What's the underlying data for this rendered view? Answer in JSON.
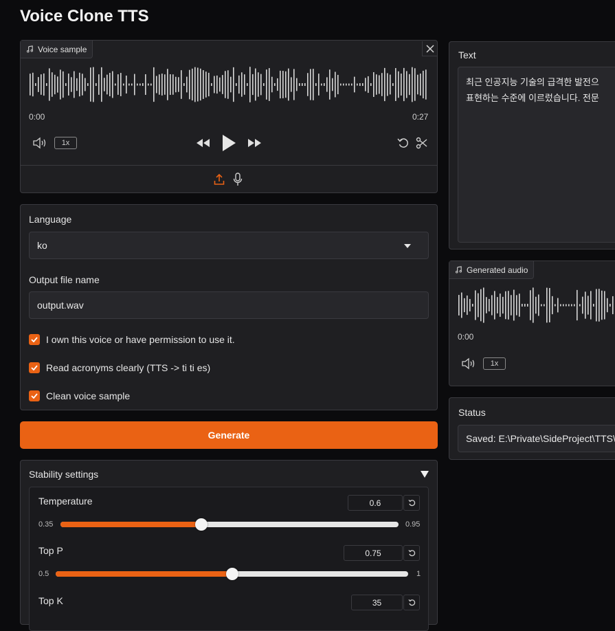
{
  "app": {
    "title": "Voice Clone TTS"
  },
  "voice_sample": {
    "tag": "Voice sample",
    "time_start": "0:00",
    "time_end": "0:27",
    "speed": "1x"
  },
  "settings": {
    "language_label": "Language",
    "language_value": "ko",
    "output_label": "Output file name",
    "output_value": "output.wav",
    "checkboxes": [
      {
        "label": "I own this voice or have permission to use it.",
        "checked": true
      },
      {
        "label": "Read acronyms clearly (TTS -> ti ti es)",
        "checked": true
      },
      {
        "label": "Clean voice sample",
        "checked": true
      }
    ]
  },
  "generate": {
    "label": "Generate"
  },
  "stability": {
    "title": "Stability settings",
    "sliders": [
      {
        "label": "Temperature",
        "value": "0.6",
        "min": "0.35",
        "max": "0.95",
        "fraction": 0.417
      },
      {
        "label": "Top P",
        "value": "0.75",
        "min": "0.5",
        "max": "1",
        "fraction": 0.5
      },
      {
        "label": "Top K",
        "value": "35"
      }
    ]
  },
  "text_panel": {
    "label": "Text",
    "line1": "최근 인공지능 기술의 급격한 발전으",
    "line2": "표현하는 수준에 이르렀습니다. 전문"
  },
  "generated_audio": {
    "tag": "Generated audio",
    "time_start": "0:00",
    "speed": "1x"
  },
  "status": {
    "label": "Status",
    "value": "Saved: E:\\Private\\SideProject\\TTS\\out"
  },
  "colors": {
    "accent": "#ea6214",
    "panel": "#1f1f22",
    "background": "#0b0b0d"
  }
}
